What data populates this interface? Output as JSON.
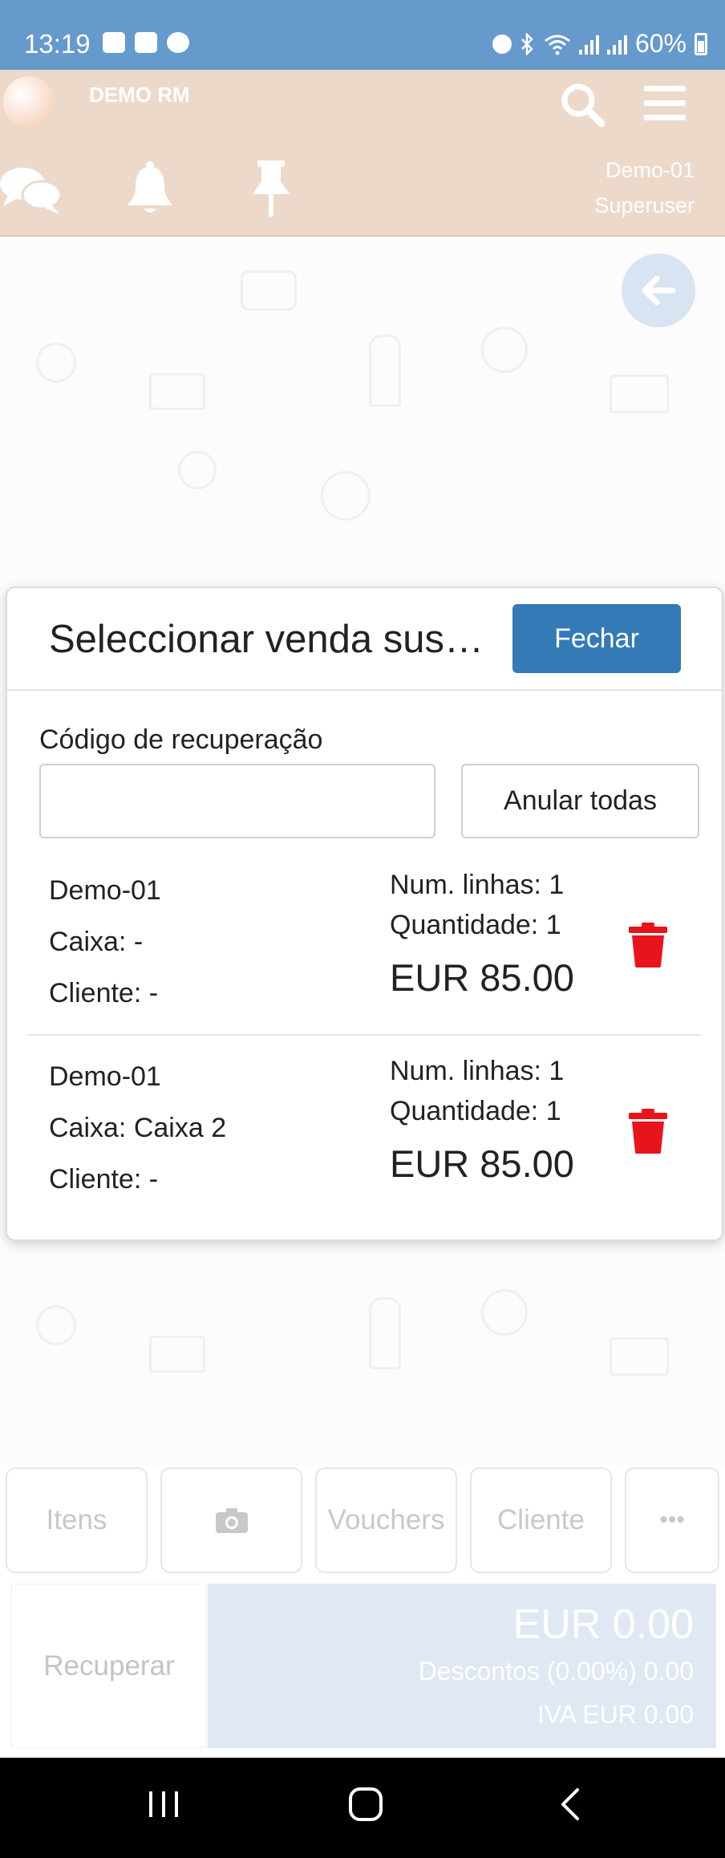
{
  "status_bar": {
    "time": "13:19",
    "battery": "60%",
    "left_icons": [
      "gallery-icon",
      "youtube-icon",
      "chrome-icon"
    ],
    "right_icons": [
      "alarm-icon",
      "bluetooth-icon",
      "wifi-icon",
      "signal-icon",
      "signal-icon",
      "battery-icon"
    ]
  },
  "header": {
    "brand": "DEMO RM",
    "user_line1": "Demo-01",
    "user_line2": "Superuser",
    "icons": [
      "chat-icon",
      "bell-icon",
      "pin-icon",
      "search-icon",
      "menu-icon"
    ]
  },
  "modal": {
    "title": "Seleccionar venda suspensa",
    "close_label": "Fechar",
    "code_label": "Código de recuperação",
    "code_value": "",
    "cancel_all_label": "Anular todas",
    "sales": [
      {
        "pos": "Demo-01",
        "caixa": "Caixa: -",
        "cliente": "Cliente: -",
        "lines": "Num. linhas: 1",
        "quantity": "Quantidade: 1",
        "total": "EUR 85.00"
      },
      {
        "pos": "Demo-01",
        "caixa": "Caixa: Caixa 2",
        "cliente": "Cliente: -",
        "lines": "Num. linhas: 1",
        "quantity": "Quantidade: 1",
        "total": "EUR 85.00"
      }
    ]
  },
  "tabs": {
    "items": "Itens",
    "vouchers": "Vouchers",
    "client": "Cliente",
    "more": "•••"
  },
  "footer": {
    "recover_label": "Recuperar",
    "total": "EUR 0.00",
    "discounts": "Descontos  (0.00%) 0.00",
    "vat": "IVA  EUR 0.00"
  },
  "colors": {
    "status_bar": "#6699cc",
    "header_bg": "#edd9ca",
    "primary": "#337ab7",
    "delete": "#e8141c",
    "totals_bg": "#dfe8f3"
  }
}
